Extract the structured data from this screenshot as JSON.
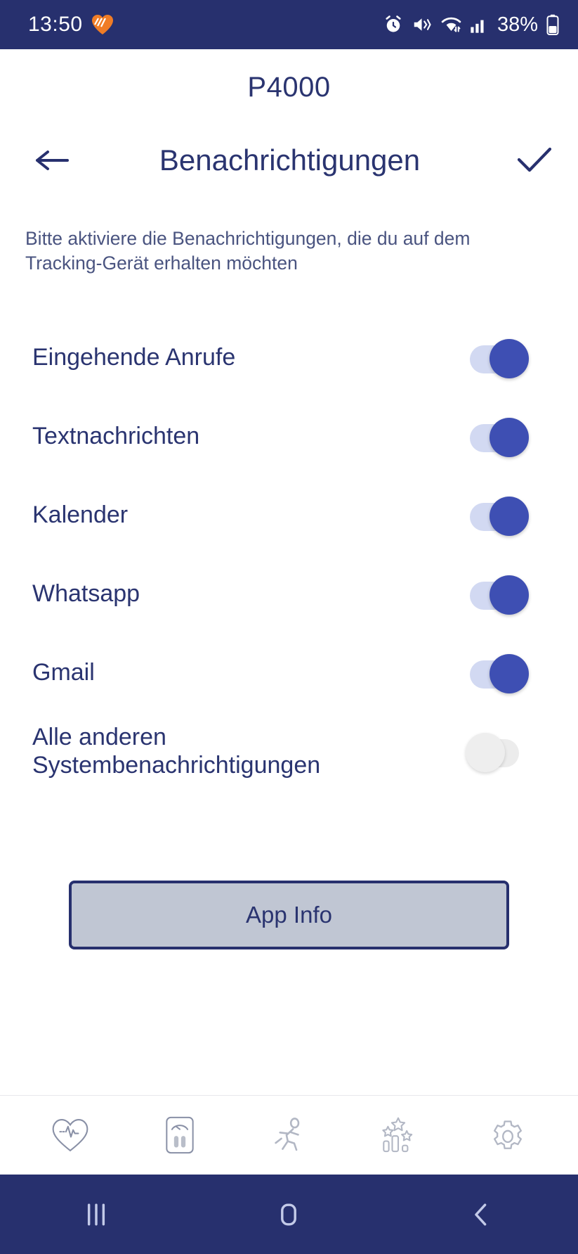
{
  "status_bar": {
    "time": "13:50",
    "battery_percent": "38%",
    "icons": [
      "heart-logo-icon",
      "alarm-icon",
      "mute-vibrate-icon",
      "wifi-icon",
      "signal-icon",
      "battery-icon"
    ],
    "background_color": "#27306e"
  },
  "app": {
    "title": "P4000"
  },
  "header": {
    "back_label": "back-arrow",
    "title": "Benachrichtigungen",
    "confirm_label": "checkmark"
  },
  "description": "Bitte aktiviere die Benachrichtigungen, die du auf dem Tracking-Gerät erhalten möchten",
  "toggles": [
    {
      "label": "Eingehende Anrufe",
      "state": "on"
    },
    {
      "label": "Textnachrichten",
      "state": "on"
    },
    {
      "label": "Kalender",
      "state": "on"
    },
    {
      "label": "Whatsapp",
      "state": "on"
    },
    {
      "label": "Gmail",
      "state": "on"
    },
    {
      "label": "Alle anderen Systembenachrichtigungen",
      "state": "off"
    }
  ],
  "app_info_button": {
    "label": "App Info"
  },
  "tab_bar": {
    "items": [
      {
        "name": "heart-rate-icon"
      },
      {
        "name": "weight-scale-icon"
      },
      {
        "name": "running-activity-icon"
      },
      {
        "name": "achievements-icon"
      },
      {
        "name": "settings-gear-icon"
      }
    ]
  },
  "nav_bar": {
    "items": [
      {
        "name": "recents-icon"
      },
      {
        "name": "home-icon"
      },
      {
        "name": "back-icon"
      }
    ]
  },
  "colors": {
    "primary": "#27306e",
    "text": "#2a3470",
    "toggle_on": "#3e4fb3",
    "toggle_track_on": "#d2d9f2",
    "toggle_off": "#eeeeee",
    "button_fill": "#c0c6d3",
    "accent_orange": "#f07c26"
  }
}
